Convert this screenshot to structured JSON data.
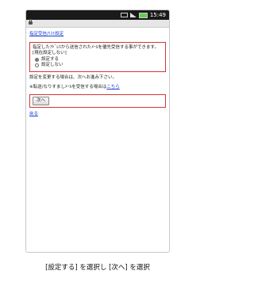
{
  "status": {
    "time": "15:49"
  },
  "page": {
    "title_link": "指定受信/ﾘｽﾄ設定",
    "description": "指定したｱﾄﾞﾚｽから送信されたﾒｰﾙを優先受信する事ができます。",
    "current_setting": "[現在設定しない]",
    "options": [
      {
        "label": "設定する",
        "checked": true
      },
      {
        "label": "設定しない",
        "checked": false
      }
    ],
    "change_note": "設定を変更する場合は、次へお進み下さい。",
    "spoof_note_prefix": "※転送/なりすましﾒｰﾙを受信する場合は",
    "spoof_note_link": "こちら",
    "next_button": "次へ",
    "back_link": "戻る"
  },
  "caption": "[設定する] を選択し [次へ] を選択"
}
